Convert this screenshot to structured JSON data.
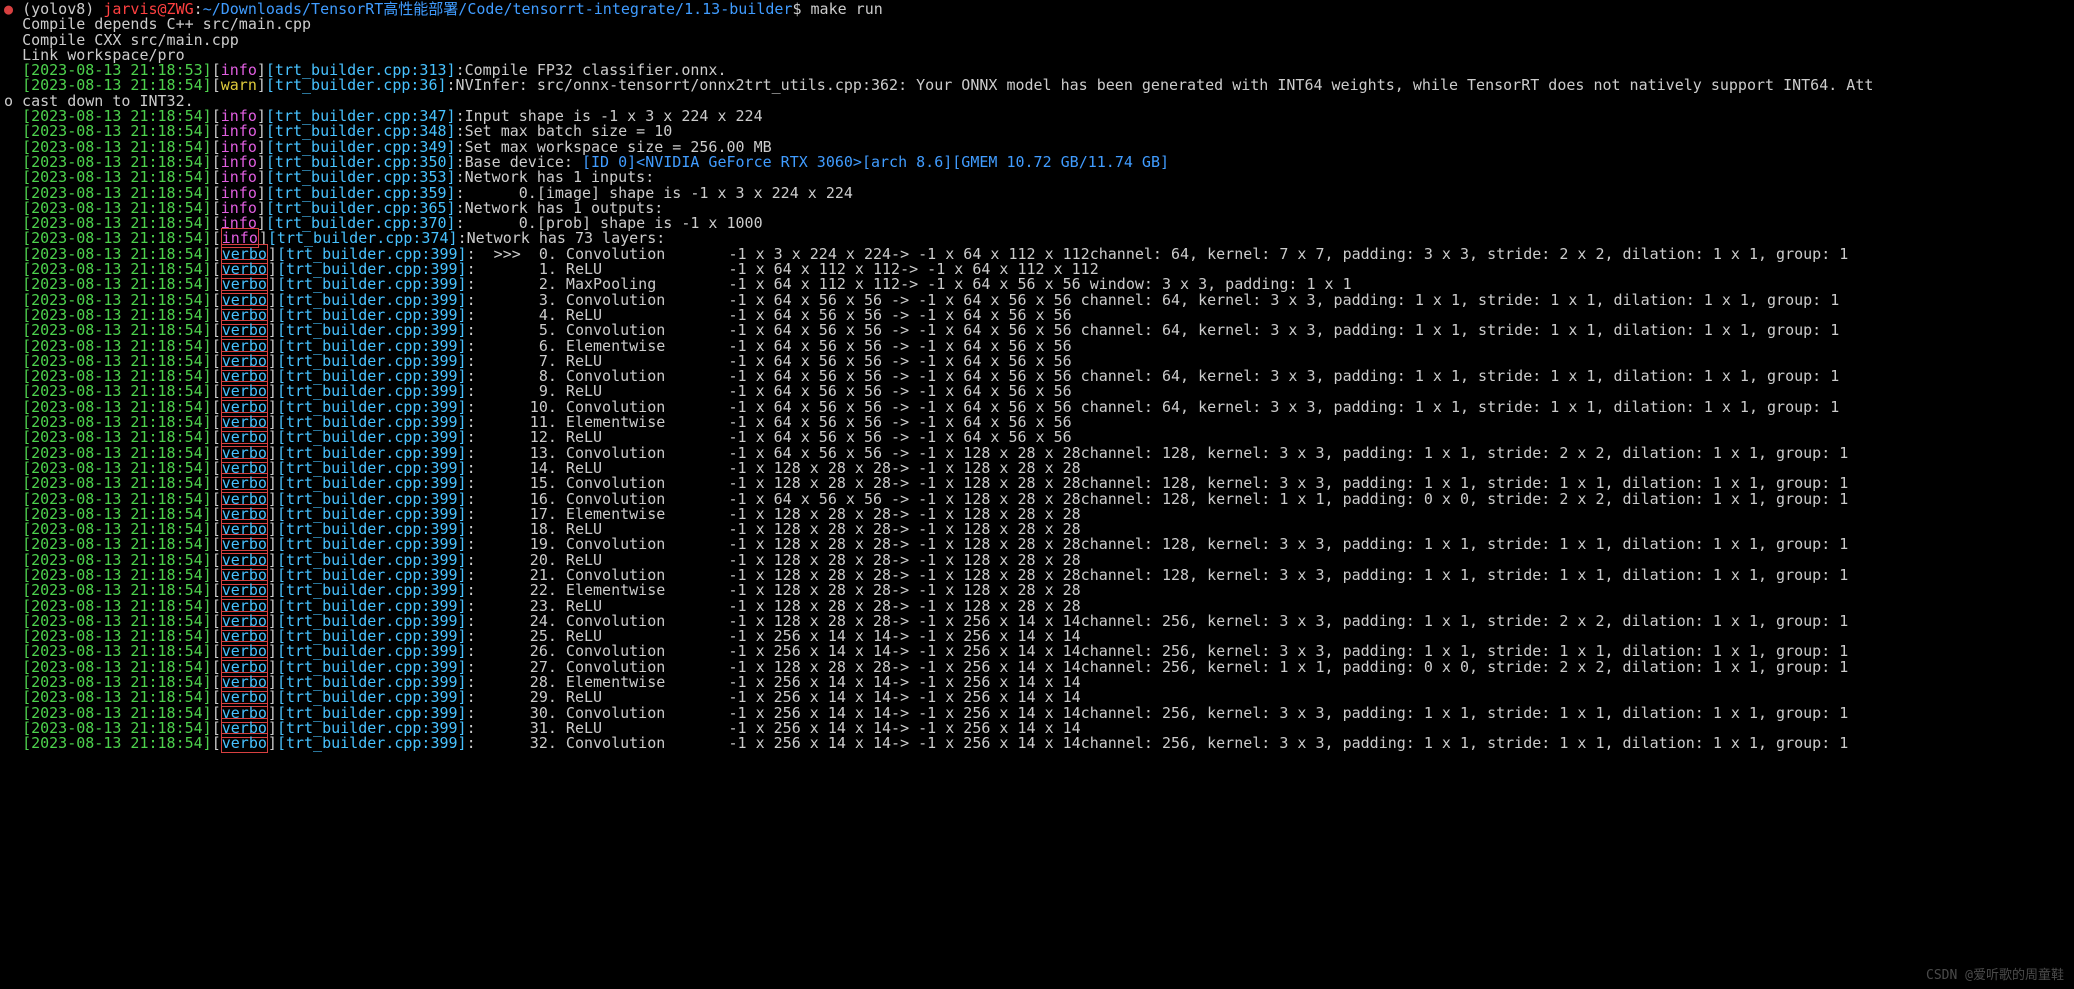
{
  "watermark": "CSDN @爱听歌的周童鞋",
  "prompt": {
    "env": "(yolov8) ",
    "user_host": "jarvis@ZWG",
    "sep": ":",
    "path": "~/Downloads/TensorRT高性能部署/Code/tensorrt-integrate/1.13-builder",
    "dollar": "$ ",
    "cmd": "make run"
  },
  "plain_lines": [
    "Compile depends C++ src/main.cpp",
    "Compile CXX src/main.cpp",
    "Link workspace/pro"
  ],
  "info_lines": [
    {
      "ts": "[2023-08-13 21:18:53]",
      "lvl": "info",
      "src": "[trt_builder.cpp:313]",
      "msg": ":Compile FP32 classifier.onnx."
    },
    {
      "ts": "[2023-08-13 21:18:54]",
      "lvl": "warn",
      "src": "[trt_builder.cpp:36]",
      "msg": ":NVInfer: src/onnx-tensorrt/onnx2trt_utils.cpp:362: Your ONNX model has been generated with INT64 weights, while TensorRT does not natively support INT64. Att",
      "wrap": "o cast down to INT32."
    },
    {
      "ts": "[2023-08-13 21:18:54]",
      "lvl": "info",
      "src": "[trt_builder.cpp:347]",
      "msg": ":Input shape is -1 x 3 x 224 x 224"
    },
    {
      "ts": "[2023-08-13 21:18:54]",
      "lvl": "info",
      "src": "[trt_builder.cpp:348]",
      "msg": ":Set max batch size = 10"
    },
    {
      "ts": "[2023-08-13 21:18:54]",
      "lvl": "info",
      "src": "[trt_builder.cpp:349]",
      "msg": ":Set max workspace size = 256.00 MB"
    },
    {
      "ts": "[2023-08-13 21:18:54]",
      "lvl": "info",
      "src": "[trt_builder.cpp:350]",
      "msg": ":Base device: ",
      "dev": "[ID 0]<NVIDIA GeForce RTX 3060>[arch 8.6][GMEM 10.72 GB/11.74 GB]"
    },
    {
      "ts": "[2023-08-13 21:18:54]",
      "lvl": "info",
      "src": "[trt_builder.cpp:353]",
      "msg": ":Network has 1 inputs:"
    },
    {
      "ts": "[2023-08-13 21:18:54]",
      "lvl": "info",
      "src": "[trt_builder.cpp:359]",
      "msg": ":      0.[image] shape is -1 x 3 x 224 x 224"
    },
    {
      "ts": "[2023-08-13 21:18:54]",
      "lvl": "info",
      "src": "[trt_builder.cpp:365]",
      "msg": ":Network has 1 outputs:"
    },
    {
      "ts": "[2023-08-13 21:18:54]",
      "lvl": "info",
      "src": "[trt_builder.cpp:370]",
      "msg": ":      0.[prob] shape is -1 x 1000"
    },
    {
      "ts": "[2023-08-13 21:18:54]",
      "lvl": "info",
      "src": "[trt_builder.cpp:374]",
      "msg": ":Network has 73 layers:",
      "boxed": true
    }
  ],
  "verbo_common": {
    "ts": "[2023-08-13 21:18:54]",
    "lvl": "verbo",
    "src": "[trt_builder.cpp:399]"
  },
  "verbo_lines": [
    {
      "n": "0",
      "arrow": true,
      "op": "Convolution",
      "shp": "-1 x 3 x 224 x 224-> -1 x 64 x 112 x 112",
      "tail": "channel: 64, kernel: 7 x 7, padding: 3 x 3, stride: 2 x 2, dilation: 1 x 1, group: 1"
    },
    {
      "n": "1",
      "op": "ReLU",
      "shp": "-1 x 64 x 112 x 112-> -1 x 64 x 112 x 112"
    },
    {
      "n": "2",
      "op": "MaxPooling",
      "shp": "-1 x 64 x 112 x 112-> -1 x 64 x 56 x 56",
      "tail": " window: 3 x 3, padding: 1 x 1"
    },
    {
      "n": "3",
      "op": "Convolution",
      "shp": "-1 x 64 x 56 x 56 -> -1 x 64 x 56 x 56",
      "tail": " channel: 64, kernel: 3 x 3, padding: 1 x 1, stride: 1 x 1, dilation: 1 x 1, group: 1"
    },
    {
      "n": "4",
      "op": "ReLU",
      "shp": "-1 x 64 x 56 x 56 -> -1 x 64 x 56 x 56"
    },
    {
      "n": "5",
      "op": "Convolution",
      "shp": "-1 x 64 x 56 x 56 -> -1 x 64 x 56 x 56",
      "tail": " channel: 64, kernel: 3 x 3, padding: 1 x 1, stride: 1 x 1, dilation: 1 x 1, group: 1"
    },
    {
      "n": "6",
      "op": "Elementwise",
      "shp": "-1 x 64 x 56 x 56 -> -1 x 64 x 56 x 56"
    },
    {
      "n": "7",
      "op": "ReLU",
      "shp": "-1 x 64 x 56 x 56 -> -1 x 64 x 56 x 56"
    },
    {
      "n": "8",
      "op": "Convolution",
      "shp": "-1 x 64 x 56 x 56 -> -1 x 64 x 56 x 56",
      "tail": " channel: 64, kernel: 3 x 3, padding: 1 x 1, stride: 1 x 1, dilation: 1 x 1, group: 1"
    },
    {
      "n": "9",
      "op": "ReLU",
      "shp": "-1 x 64 x 56 x 56 -> -1 x 64 x 56 x 56"
    },
    {
      "n": "10",
      "op": "Convolution",
      "shp": "-1 x 64 x 56 x 56 -> -1 x 64 x 56 x 56",
      "tail": " channel: 64, kernel: 3 x 3, padding: 1 x 1, stride: 1 x 1, dilation: 1 x 1, group: 1"
    },
    {
      "n": "11",
      "op": "Elementwise",
      "shp": "-1 x 64 x 56 x 56 -> -1 x 64 x 56 x 56"
    },
    {
      "n": "12",
      "op": "ReLU",
      "shp": "-1 x 64 x 56 x 56 -> -1 x 64 x 56 x 56"
    },
    {
      "n": "13",
      "op": "Convolution",
      "shp": "-1 x 64 x 56 x 56 -> -1 x 128 x 28 x 28",
      "tail": "channel: 128, kernel: 3 x 3, padding: 1 x 1, stride: 2 x 2, dilation: 1 x 1, group: 1"
    },
    {
      "n": "14",
      "op": "ReLU",
      "shp": "-1 x 128 x 28 x 28-> -1 x 128 x 28 x 28"
    },
    {
      "n": "15",
      "op": "Convolution",
      "shp": "-1 x 128 x 28 x 28-> -1 x 128 x 28 x 28",
      "tail": "channel: 128, kernel: 3 x 3, padding: 1 x 1, stride: 1 x 1, dilation: 1 x 1, group: 1"
    },
    {
      "n": "16",
      "op": "Convolution",
      "shp": "-1 x 64 x 56 x 56 -> -1 x 128 x 28 x 28",
      "tail": "channel: 128, kernel: 1 x 1, padding: 0 x 0, stride: 2 x 2, dilation: 1 x 1, group: 1"
    },
    {
      "n": "17",
      "op": "Elementwise",
      "shp": "-1 x 128 x 28 x 28-> -1 x 128 x 28 x 28"
    },
    {
      "n": "18",
      "op": "ReLU",
      "shp": "-1 x 128 x 28 x 28-> -1 x 128 x 28 x 28"
    },
    {
      "n": "19",
      "op": "Convolution",
      "shp": "-1 x 128 x 28 x 28-> -1 x 128 x 28 x 28",
      "tail": "channel: 128, kernel: 3 x 3, padding: 1 x 1, stride: 1 x 1, dilation: 1 x 1, group: 1"
    },
    {
      "n": "20",
      "op": "ReLU",
      "shp": "-1 x 128 x 28 x 28-> -1 x 128 x 28 x 28"
    },
    {
      "n": "21",
      "op": "Convolution",
      "shp": "-1 x 128 x 28 x 28-> -1 x 128 x 28 x 28",
      "tail": "channel: 128, kernel: 3 x 3, padding: 1 x 1, stride: 1 x 1, dilation: 1 x 1, group: 1"
    },
    {
      "n": "22",
      "op": "Elementwise",
      "shp": "-1 x 128 x 28 x 28-> -1 x 128 x 28 x 28"
    },
    {
      "n": "23",
      "op": "ReLU",
      "shp": "-1 x 128 x 28 x 28-> -1 x 128 x 28 x 28"
    },
    {
      "n": "24",
      "op": "Convolution",
      "shp": "-1 x 128 x 28 x 28-> -1 x 256 x 14 x 14",
      "tail": "channel: 256, kernel: 3 x 3, padding: 1 x 1, stride: 2 x 2, dilation: 1 x 1, group: 1"
    },
    {
      "n": "25",
      "op": "ReLU",
      "shp": "-1 x 256 x 14 x 14-> -1 x 256 x 14 x 14"
    },
    {
      "n": "26",
      "op": "Convolution",
      "shp": "-1 x 256 x 14 x 14-> -1 x 256 x 14 x 14",
      "tail": "channel: 256, kernel: 3 x 3, padding: 1 x 1, stride: 1 x 1, dilation: 1 x 1, group: 1"
    },
    {
      "n": "27",
      "op": "Convolution",
      "shp": "-1 x 128 x 28 x 28-> -1 x 256 x 14 x 14",
      "tail": "channel: 256, kernel: 1 x 1, padding: 0 x 0, stride: 2 x 2, dilation: 1 x 1, group: 1"
    },
    {
      "n": "28",
      "op": "Elementwise",
      "shp": "-1 x 256 x 14 x 14-> -1 x 256 x 14 x 14"
    },
    {
      "n": "29",
      "op": "ReLU",
      "shp": "-1 x 256 x 14 x 14-> -1 x 256 x 14 x 14"
    },
    {
      "n": "30",
      "op": "Convolution",
      "shp": "-1 x 256 x 14 x 14-> -1 x 256 x 14 x 14",
      "tail": "channel: 256, kernel: 3 x 3, padding: 1 x 1, stride: 1 x 1, dilation: 1 x 1, group: 1"
    },
    {
      "n": "31",
      "op": "ReLU",
      "shp": "-1 x 256 x 14 x 14-> -1 x 256 x 14 x 14"
    },
    {
      "n": "32",
      "op": "Convolution",
      "shp": "-1 x 256 x 14 x 14-> -1 x 256 x 14 x 14",
      "tail": "channel: 256, kernel: 3 x 3, padding: 1 x 1, stride: 1 x 1, dilation: 1 x 1, group: 1"
    }
  ],
  "layout": {
    "prefix_width": 7,
    "op_width": 18,
    "shape_start_col": 79
  }
}
